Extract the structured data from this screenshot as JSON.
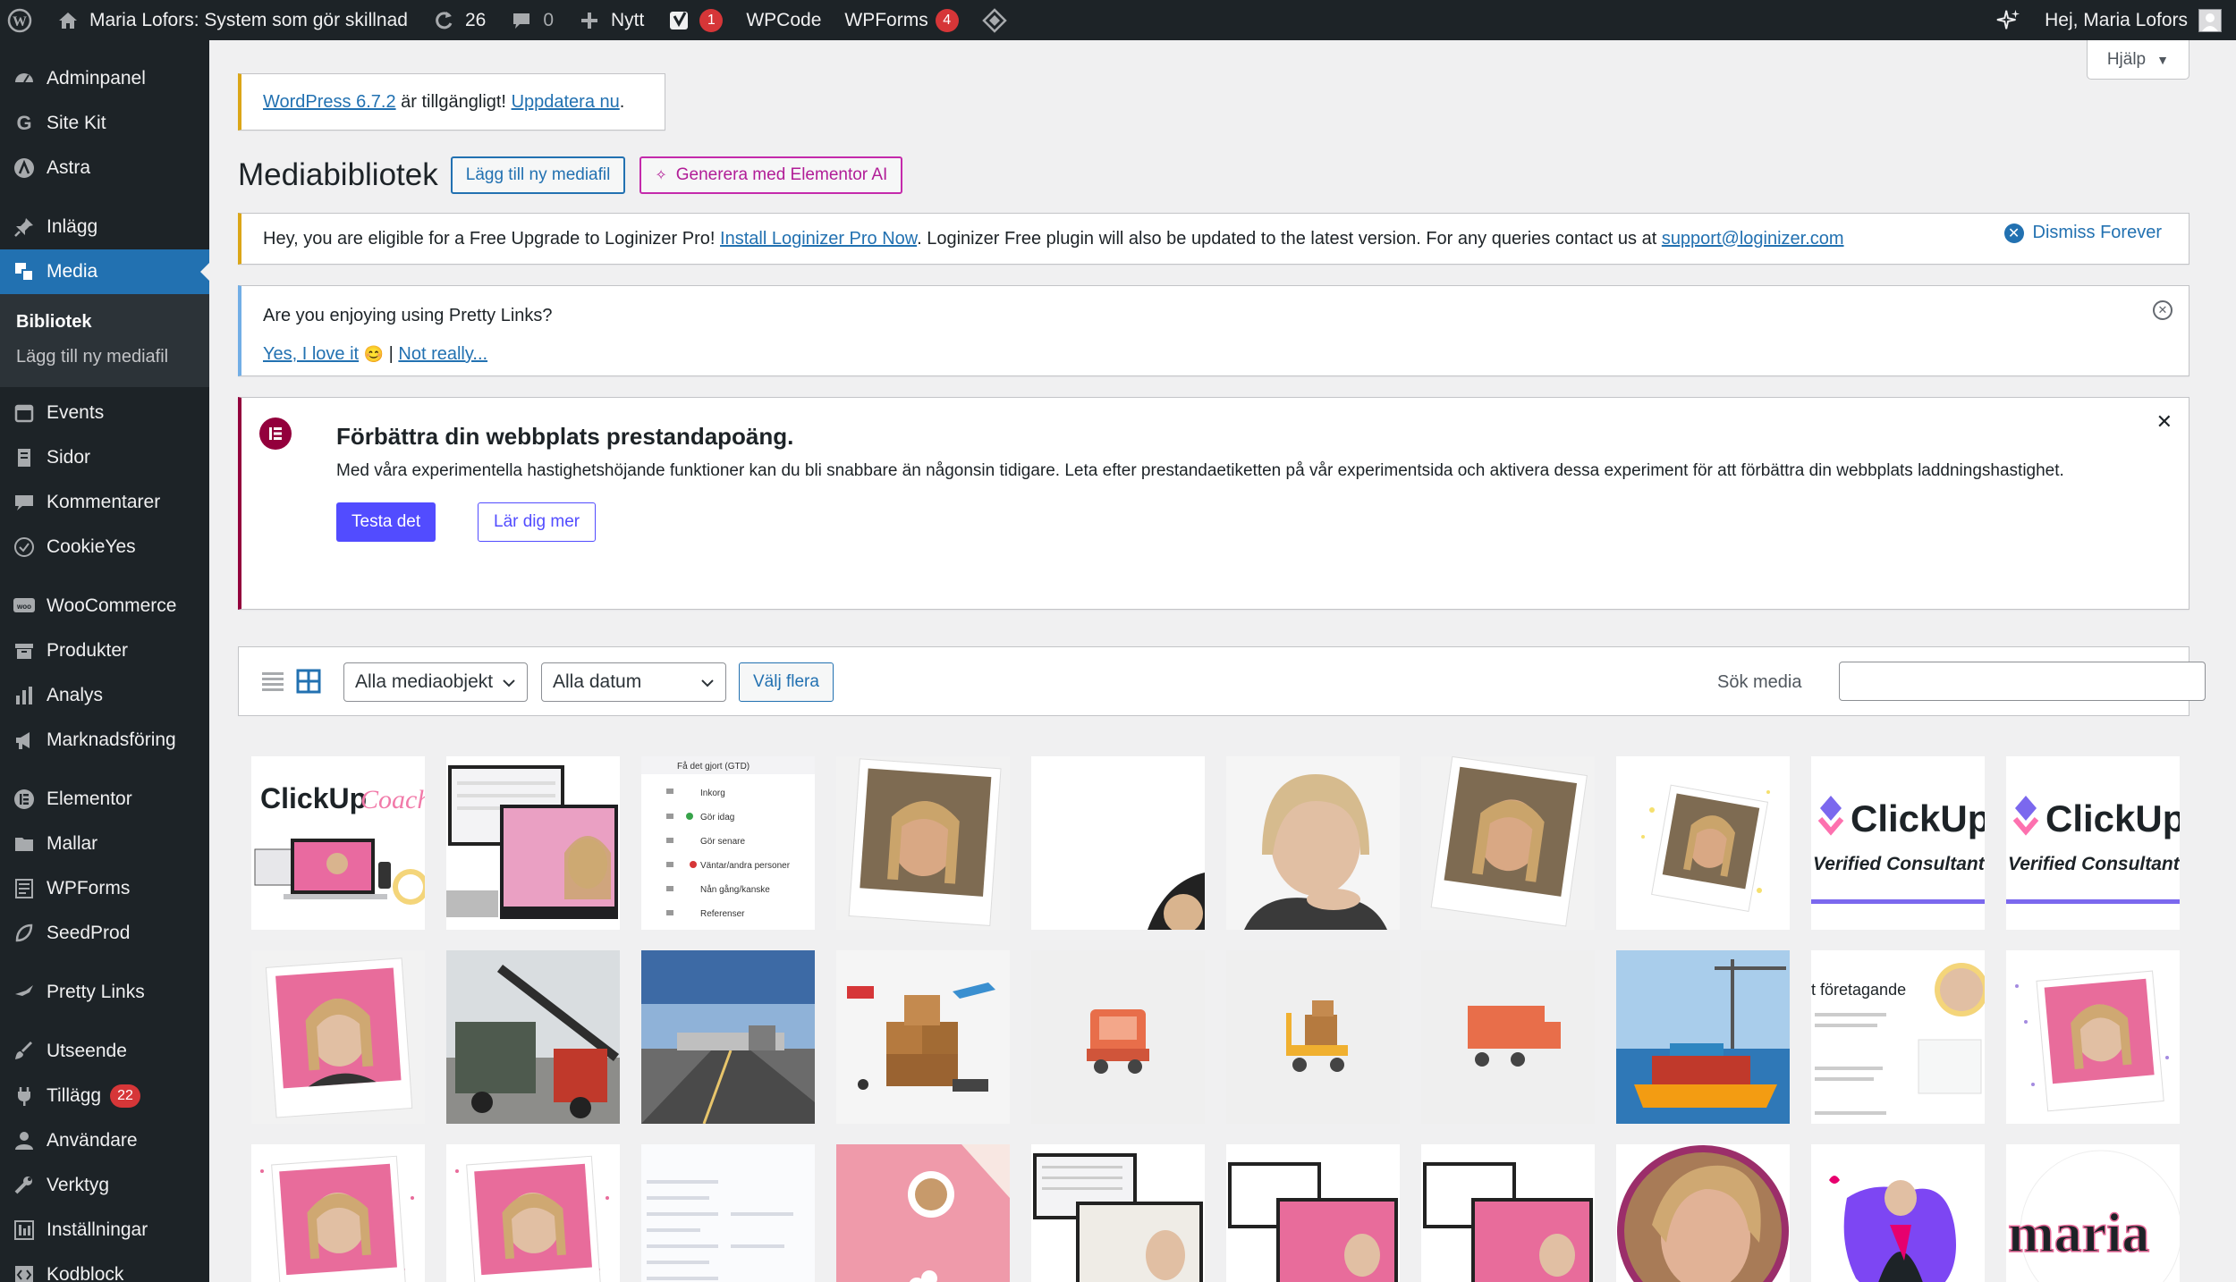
{
  "adminbar": {
    "site_name": "Maria Lofors: System som gör skillnad",
    "updates_count": "26",
    "comments_count": "0",
    "new_label": "Nytt",
    "yoast_badge": "1",
    "wpcode_label": "WPCode",
    "wpforms_label": "WPForms",
    "wpforms_badge": "4",
    "greeting": "Hej, Maria Lofors"
  },
  "sidebar": {
    "items": [
      {
        "label": "Adminpanel",
        "icon": "dashboard-icon"
      },
      {
        "label": "Site Kit",
        "icon": "google-g-icon"
      },
      {
        "label": "Astra",
        "icon": "astra-icon"
      },
      {
        "label": "Inlägg",
        "icon": "pin-icon"
      },
      {
        "label": "Media",
        "icon": "media-icon"
      },
      {
        "label": "Events",
        "icon": "calendar-icon"
      },
      {
        "label": "Sidor",
        "icon": "page-icon"
      },
      {
        "label": "Kommentarer",
        "icon": "comment-icon"
      },
      {
        "label": "CookieYes",
        "icon": "cookie-icon"
      },
      {
        "label": "WooCommerce",
        "icon": "woo-icon"
      },
      {
        "label": "Produkter",
        "icon": "archive-icon"
      },
      {
        "label": "Analys",
        "icon": "bar-chart-icon"
      },
      {
        "label": "Marknadsföring",
        "icon": "megaphone-icon"
      },
      {
        "label": "Elementor",
        "icon": "elementor-icon"
      },
      {
        "label": "Mallar",
        "icon": "folder-icon"
      },
      {
        "label": "WPForms",
        "icon": "form-icon"
      },
      {
        "label": "SeedProd",
        "icon": "seed-icon"
      },
      {
        "label": "Pretty Links",
        "icon": "star-icon"
      },
      {
        "label": "Utseende",
        "icon": "brush-icon"
      },
      {
        "label": "Tillägg",
        "icon": "plugin-icon",
        "badge": "22"
      },
      {
        "label": "Användare",
        "icon": "user-icon"
      },
      {
        "label": "Verktyg",
        "icon": "wrench-icon"
      },
      {
        "label": "Inställningar",
        "icon": "settings-icon"
      },
      {
        "label": "Kodblock",
        "icon": "code-icon"
      }
    ],
    "submenu": [
      "Bibliotek",
      "Lägg till ny mediafil"
    ]
  },
  "help_label": "Hjälp",
  "update_notice": {
    "link": "WordPress 6.7.2",
    "text": " är tillgängligt! ",
    "update_link": "Uppdatera nu",
    "end": "."
  },
  "page": {
    "title": "Mediabibliotek",
    "add_button": "Lägg till ny mediafil",
    "ai_button": "Generera med Elementor AI"
  },
  "loginizer": {
    "text1": "Hey, you are eligible for a Free Upgrade to Loginizer Pro! ",
    "link1": "Install Loginizer Pro Now",
    "text2": ". Loginizer Free plugin will also be updated to the latest version. For any queries contact us at ",
    "email": "support@loginizer.com",
    "dismiss": "Dismiss Forever"
  },
  "prettylinks": {
    "question": "Are you enjoying using Pretty Links?",
    "yes": "Yes, I love it",
    "sep": " | ",
    "no": "Not really..."
  },
  "elementor_notice": {
    "title": "Förbättra din webbplats prestandapoäng.",
    "body": "Med våra experimentella hastighetshöjande funktioner kan du bli snabbare än någonsin tidigare. Leta efter prestandaetiketten på vår experimentsida och aktivera dessa experiment för att förbättra din webbplats laddningshastighet.",
    "primary": "Testa det",
    "secondary": "Lär dig mer"
  },
  "toolbar": {
    "filter_type": "Alla mediaobjekt",
    "filter_date": "Alla datum",
    "select_multiple": "Välj flera",
    "search_label": "Sök media",
    "search_value": ""
  },
  "thumb_text": {
    "clickup_coach_word": "ClickUp",
    "coach_word": "Coach",
    "gtd_title": "Få det gjort (GTD)",
    "gtd_rows": [
      "Inkorg",
      "Gör idag",
      "Gör senare",
      "Väntar/andra personer",
      "Nån gång/kanske",
      "Referenser"
    ],
    "clickup_logo": "ClickUp",
    "verified": "Verified Consultant",
    "foretagande": "t företagande",
    "maria": "maria"
  }
}
